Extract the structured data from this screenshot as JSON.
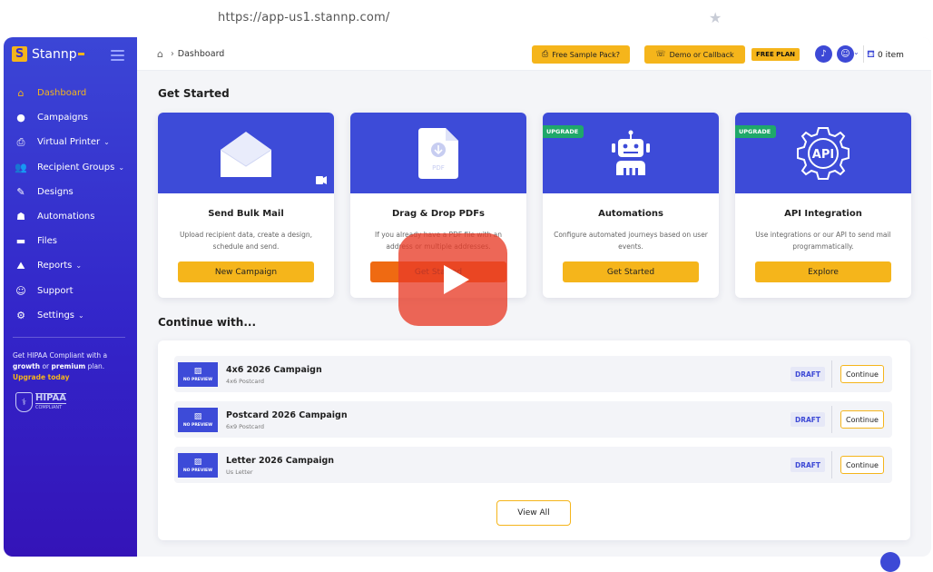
{
  "browser": {
    "url": "https://app-us1.stannp.com/"
  },
  "brand": {
    "logo_letter": "S",
    "name": "Stannp"
  },
  "sidebar": {
    "items": [
      {
        "label": "Dashboard",
        "icon": "home-icon",
        "glyph": "⌂",
        "chevron": ""
      },
      {
        "label": "Campaigns",
        "icon": "chat-bubble-icon",
        "glyph": "●",
        "chevron": ""
      },
      {
        "label": "Virtual Printer",
        "icon": "printer-icon",
        "glyph": "⎙",
        "chevron": "⌄"
      },
      {
        "label": "Recipient Groups",
        "icon": "users-icon",
        "glyph": "👥",
        "chevron": "⌄"
      },
      {
        "label": "Designs",
        "icon": "designs-icon",
        "glyph": "✎",
        "chevron": ""
      },
      {
        "label": "Automations",
        "icon": "robot-icon",
        "glyph": "☗",
        "chevron": ""
      },
      {
        "label": "Files",
        "icon": "folder-icon",
        "glyph": "▬",
        "chevron": ""
      },
      {
        "label": "Reports",
        "icon": "chart-icon",
        "glyph": "⛰",
        "chevron": "⌄"
      },
      {
        "label": "Support",
        "icon": "support-icon",
        "glyph": "☺",
        "chevron": ""
      },
      {
        "label": "Settings",
        "icon": "sliders-icon",
        "glyph": "⚙",
        "chevron": "⌄"
      }
    ],
    "hipaa_promo": {
      "line1": "Get HIPAA Compliant with a",
      "growth": "growth",
      "or": " or ",
      "premium": "premium",
      "plan": " plan.",
      "upgrade": "Upgrade today"
    },
    "hipaa_badge": {
      "title": "HIPAA",
      "sub": "COMPLIANT"
    }
  },
  "topbar": {
    "breadcrumb": "Dashboard",
    "free_sample": "Free Sample Pack?",
    "demo": "Demo or Callback",
    "plan": "FREE PLAN",
    "cart": "0 item"
  },
  "main": {
    "get_started_title": "Get Started",
    "continue_title": "Continue with...",
    "cards": [
      {
        "title": "Send Bulk Mail",
        "desc": "Upload recipient data, create a design, schedule and send.",
        "button": "New Campaign",
        "badge": ""
      },
      {
        "title": "Drag & Drop PDFs",
        "desc": "If you already have a PDF file with an address or multiple addresses.",
        "button": "Get Started",
        "badge": ""
      },
      {
        "title": "Automations",
        "desc": "Configure automated journeys based on user events.",
        "button": "Get Started",
        "badge": "UPGRADE"
      },
      {
        "title": "API Integration",
        "desc": "Use integrations or our API to send mail programmatically.",
        "button": "Explore",
        "badge": "UPGRADE"
      }
    ],
    "pdf_label": "PDF",
    "api_label": "API",
    "campaigns": [
      {
        "title": "4x6 2026 Campaign",
        "sub": "4x6 Postcard",
        "status": "DRAFT",
        "action": "Continue",
        "thumb": "NO PREVIEW"
      },
      {
        "title": "Postcard 2026 Campaign",
        "sub": "6x9 Postcard",
        "status": "DRAFT",
        "action": "Continue",
        "thumb": "NO PREVIEW"
      },
      {
        "title": "Letter 2026 Campaign",
        "sub": "Us Letter",
        "status": "DRAFT",
        "action": "Continue",
        "thumb": "NO PREVIEW"
      }
    ],
    "view_all": "View All"
  },
  "colors": {
    "accent": "#f5b51b",
    "brand": "#3d49d6",
    "upgrade": "#1fa86a",
    "video": "#e83c28"
  }
}
